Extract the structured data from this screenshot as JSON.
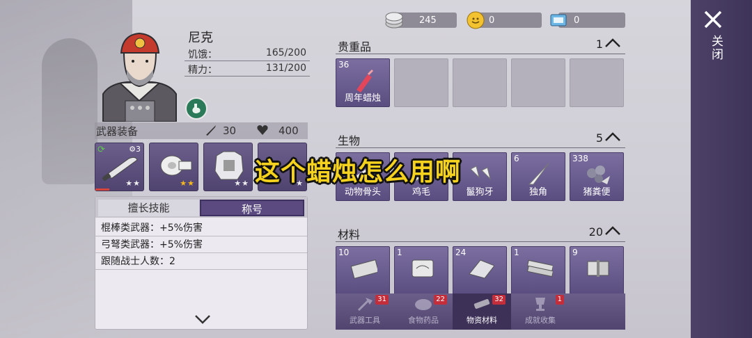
{
  "currency": [
    {
      "name": "silver-coins",
      "value": "245"
    },
    {
      "name": "gold-coin",
      "value": "0"
    },
    {
      "name": "ticket",
      "value": "0"
    }
  ],
  "character": {
    "name": "尼克",
    "hunger_label": "饥饿：",
    "hunger_value": "165/200",
    "energy_label": "精力：",
    "energy_value": "131/200"
  },
  "equipment": {
    "title": "武器装备",
    "attack": "30",
    "health": "400",
    "weapon_level": "3"
  },
  "skills": {
    "tab1": "擅长技能",
    "tab2": "称号",
    "lines": [
      "棍棒类武器：+5%伤害",
      "弓弩类武器：+5%伤害",
      "跟随战士人数：2"
    ]
  },
  "sections": [
    {
      "title": "贵重品",
      "count": "1"
    },
    {
      "title": "生物",
      "count": "5"
    },
    {
      "title": "材料",
      "count": "20"
    }
  ],
  "valuables": [
    {
      "num": "36",
      "label": "周年蜡烛"
    }
  ],
  "creatures": [
    {
      "num": "",
      "label": "动物骨头"
    },
    {
      "num": "",
      "label": "鸡毛"
    },
    {
      "num": "",
      "label": "鬣狗牙"
    },
    {
      "num": "6",
      "label": "独角"
    },
    {
      "num": "338",
      "label": "猪粪便"
    }
  ],
  "materials": [
    {
      "num": "10"
    },
    {
      "num": "1"
    },
    {
      "num": "24"
    },
    {
      "num": "1"
    },
    {
      "num": "9"
    }
  ],
  "tabs": [
    {
      "label": "武器工具",
      "badge": "31"
    },
    {
      "label": "食物药品",
      "badge": "22"
    },
    {
      "label": "物资材料",
      "badge": "32"
    },
    {
      "label": "成就收集",
      "badge": "1"
    }
  ],
  "close_label": "关闭",
  "caption": "这个蜡烛怎么用啊"
}
